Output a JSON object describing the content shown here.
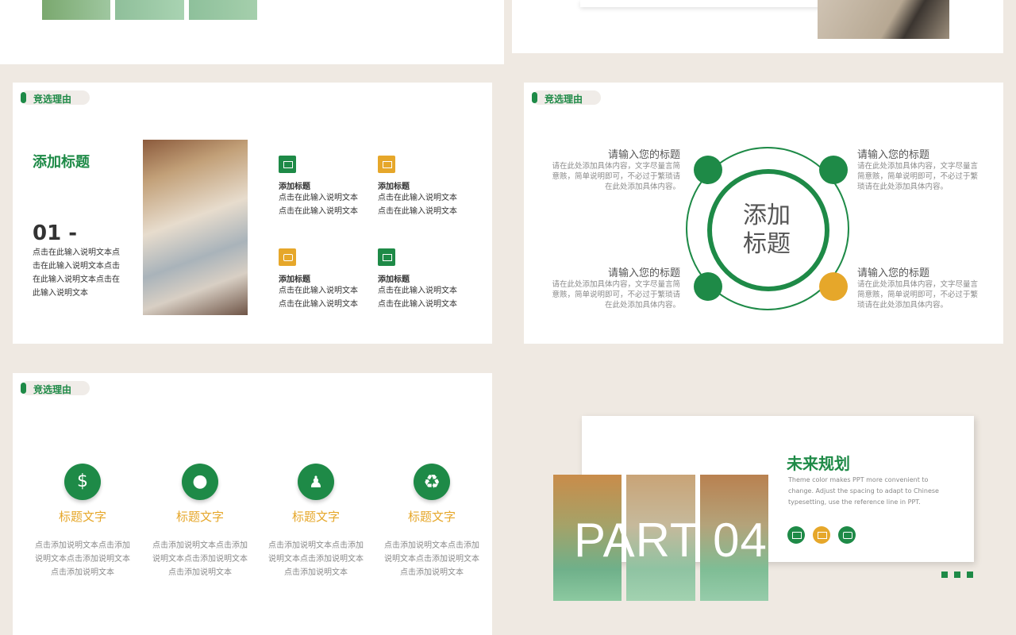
{
  "tag_label": "竞选理由",
  "slide_a": {
    "title": "添加标题",
    "number": "01 -",
    "desc": "点击在此输入说明文本点击在此输入说明文本点击在此输入说明文本点击在此输入说明文本",
    "features": [
      {
        "icon": "briefcase-icon",
        "color": "#1e8a47",
        "title": "添加标题",
        "text": "点击在此输入说明文本点击在此输入说明文本"
      },
      {
        "icon": "mail-icon",
        "color": "#e6a72a",
        "title": "添加标题",
        "text": "点击在此输入说明文本点击在此输入说明文本"
      },
      {
        "icon": "chat-icon",
        "color": "#e6a72a",
        "title": "添加标题",
        "text": "点击在此输入说明文本点击在此输入说明文本"
      },
      {
        "icon": "picture-icon",
        "color": "#1e8a47",
        "title": "添加标题",
        "text": "点击在此输入说明文本点击在此输入说明文本"
      }
    ]
  },
  "slide_b": {
    "center_title": "添加标题",
    "items": [
      {
        "title": "请输入您的标题",
        "text": "请在此处添加具体内容，文字尽量言简意赅，简单说明即可，不必过于繁琐请在此处添加具体内容。"
      },
      {
        "title": "请输入您的标题",
        "text": "请在此处添加具体内容，文字尽量言简意赅，简单说明即可，不必过于繁琐请在此处添加具体内容。"
      },
      {
        "title": "请输入您的标题",
        "text": "请在此处添加具体内容，文字尽量言简意赅，简单说明即可，不必过于繁琐请在此处添加具体内容。"
      },
      {
        "title": "请输入您的标题",
        "text": "请在此处添加具体内容，文字尽量言简意赅，简单说明即可，不必过于繁琐请在此处添加具体内容。"
      }
    ]
  },
  "slide_c": {
    "items": [
      {
        "icon": "money-cycle-icon",
        "title": "标题文字",
        "text": "点击添加说明文本点击添加说明文本点击添加说明文本点击添加说明文本"
      },
      {
        "icon": "user-idea-icon",
        "title": "标题文字",
        "text": "点击添加说明文本点击添加说明文本点击添加说明文本点击添加说明文本"
      },
      {
        "icon": "runner-money-icon",
        "title": "标题文字",
        "text": "点击添加说明文本点击添加说明文本点击添加说明文本点击添加说明文本"
      },
      {
        "icon": "recycle-icon",
        "title": "标题文字",
        "text": "点击添加说明文本点击添加说明文本点击添加说明文本点击添加说明文本"
      }
    ]
  },
  "slide_d": {
    "part_label": "PART 04",
    "title": "未来规划",
    "desc": "Theme  color makes PPT more  convenient to change. Adjust the spacing to adapt to Chinese typesetting, use the reference  line in PPT.",
    "icons": [
      {
        "icon": "picture-icon",
        "color": "#1e8a47"
      },
      {
        "icon": "briefcase-icon",
        "color": "#e6a72a"
      },
      {
        "icon": "chat-icon",
        "color": "#1e8a47"
      }
    ]
  },
  "colors": {
    "green": "#1e8a47",
    "orange": "#e6a72a",
    "bg": "#efe9e2"
  }
}
